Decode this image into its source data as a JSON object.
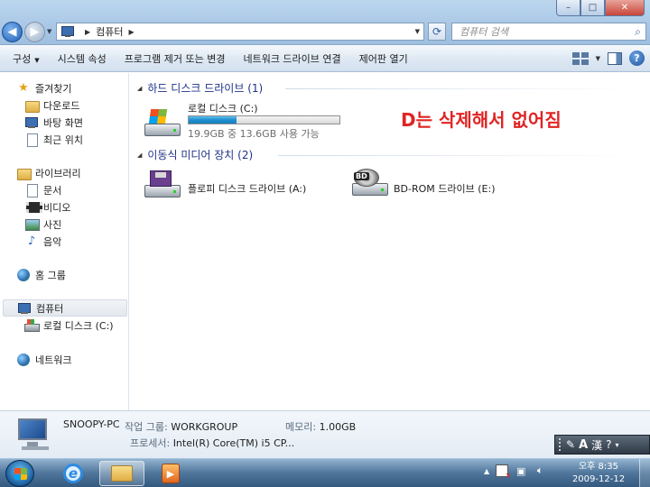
{
  "window": {
    "controls": {
      "minimize": "–",
      "maximize": "□",
      "close": "✕"
    }
  },
  "address": {
    "location": "컴퓨터",
    "search_placeholder": "컴퓨터 검색"
  },
  "toolbar": {
    "items": [
      "구성",
      "시스템 속성",
      "프로그램 제거 또는 변경",
      "네트워크 드라이브 연결",
      "제어판 열기"
    ],
    "help": "?"
  },
  "nav": {
    "favorites": "즐겨찾기",
    "downloads": "다운로드",
    "desktop": "바탕 화면",
    "recent": "최근 위치",
    "libraries": "라이브러리",
    "documents": "문서",
    "videos": "비디오",
    "pictures": "사진",
    "music": "음악",
    "homegroup": "홈 그룹",
    "computer": "컴퓨터",
    "local_disk": "로컬 디스크 (C:)",
    "network": "네트워크"
  },
  "content": {
    "hdd_group": "하드 디스크 드라이브 (1)",
    "removable_group": "이동식 미디어 장치 (2)",
    "local_disk": {
      "name": "로컬 디스크 (C:)",
      "capacity": "19.9GB 중 13.6GB 사용 가능",
      "used_fraction": 0.32
    },
    "floppy": "플로피 디스크 드라이브 (A:)",
    "bdrom": "BD-ROM 드라이브 (E:)",
    "bd_tag": "BD",
    "annotation": "D는 삭제해서 없어짐"
  },
  "details": {
    "pc_name": "SNOOPY-PC",
    "workgroup_label": "작업 그룹:",
    "workgroup": "WORKGROUP",
    "memory_label": "메모리:",
    "memory": "1.00GB",
    "processor_label": "프로세서:",
    "processor": "Intel(R) Core(TM) i5 CP..."
  },
  "langbar": {
    "a": "A",
    "hanja": "漢"
  },
  "taskbar": {
    "ie_glyph": "e",
    "time": "오후 8:35",
    "date": "2009-12-12"
  },
  "colors": {
    "annotation": "#e02424",
    "group_header": "#1e3287",
    "progress": "#1e8ecf"
  }
}
